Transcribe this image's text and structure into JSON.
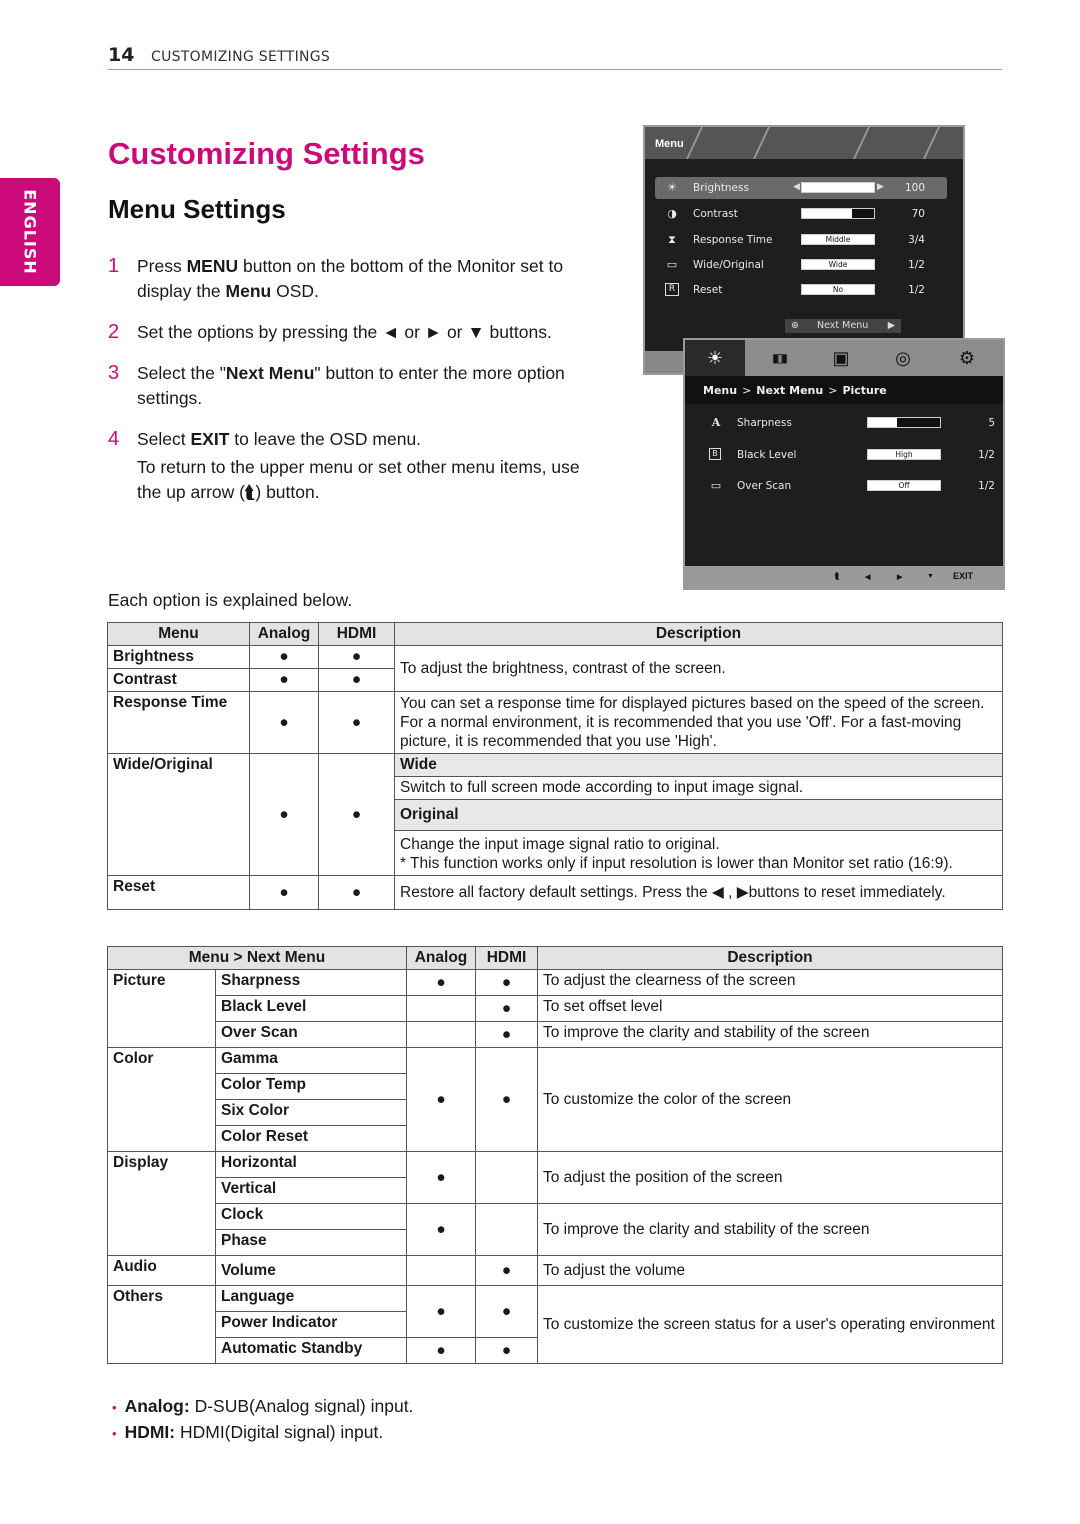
{
  "header": {
    "page_number": "14",
    "section": "CUSTOMIZING SETTINGS"
  },
  "language_tab": "ENGLISH",
  "title": "Customizing Settings",
  "subtitle": "Menu Settings",
  "steps": [
    {
      "num": "1",
      "pre": "Press ",
      "bold1": "MENU",
      "mid": " button on the bottom of the Monitor set to display the ",
      "bold2": "Menu",
      "post": " OSD."
    },
    {
      "num": "2",
      "text": "Set the options by pressing the ◄ or ► or ▼ buttons."
    },
    {
      "num": "3",
      "pre": "Select the \"",
      "bold1": "Next Menu",
      "post": "\" button to enter the more option settings."
    },
    {
      "num": "4",
      "pre": "Select ",
      "bold1": "EXIT",
      "post": " to leave the OSD menu.",
      "sub_pre": "To return to the upper menu or set other menu items, use the up arrow (",
      "sub_icon": "⮬",
      "sub_post": ") button."
    }
  ],
  "explain": "Each option is explained below.",
  "osd_main": {
    "title": "Menu",
    "rows": [
      {
        "icon": "☀",
        "label": "Brightness",
        "value": "100",
        "level": 1.0,
        "selected": true
      },
      {
        "icon": "◑",
        "label": "Contrast",
        "value": "70",
        "level": 0.7
      },
      {
        "icon": "⧗",
        "label": "Response Time",
        "option": "Middle",
        "value": "3/4"
      },
      {
        "icon": "▭",
        "label": "Wide/Original",
        "option": "Wide",
        "value": "1/2"
      },
      {
        "icon": "R",
        "label": "Reset",
        "option": "No",
        "value": "1/2"
      }
    ],
    "next_menu": "Next Menu",
    "plus_icon": "⊕",
    "right_arrow": "▶",
    "left_arrow": "◀"
  },
  "osd_next": {
    "tabs": [
      "☀",
      "▮▯▮",
      "▣",
      "◎",
      "⚙"
    ],
    "breadcrumb": [
      "Menu",
      "Next Menu",
      "Picture"
    ],
    "sep": ">",
    "rows": [
      {
        "icon": "A",
        "label": "Sharpness",
        "value": "5",
        "level": 0.4
      },
      {
        "icon": "B",
        "label": "Black Level",
        "option": "High",
        "value": "1/2"
      },
      {
        "icon": "▭",
        "label": "Over Scan",
        "option": "Off",
        "value": "1/2"
      }
    ],
    "footer": {
      "up": "⮬",
      "left": "◀",
      "right": "▶",
      "down": "▼",
      "exit": "EXIT"
    }
  },
  "table1": {
    "headers": [
      "Menu",
      "Analog",
      "HDMI",
      "Description"
    ],
    "dot": "●",
    "brightness": "Brightness",
    "contrast": "Contrast",
    "bc_desc": "To adjust the brightness, contrast of the screen.",
    "response_time": "Response Time",
    "rt_desc": "You can set a response time for displayed pictures based on the speed of the screen. For a normal environment, it is recommended that you use 'Off'. For a fast-moving picture, it is recommended that you use 'High'.",
    "wide_original": "Wide/Original",
    "wide": "Wide",
    "wide_desc": "Switch to full screen mode according to input image signal.",
    "original": "Original",
    "original_desc": "Change the input image signal ratio to original.",
    "original_note": "* This function works only if input resolution is lower than Monitor set ratio (16:9).",
    "reset": "Reset",
    "reset_desc": "Restore all factory default settings. Press the ◀ , ▶buttons to reset immediately."
  },
  "table2": {
    "headers": [
      "Menu > Next Menu",
      "Analog",
      "HDMI",
      "Description"
    ],
    "dot": "●",
    "groups": {
      "picture": "Picture",
      "color": "Color",
      "display": "Display",
      "audio": "Audio",
      "others": "Others"
    },
    "items": {
      "sharpness": "Sharpness",
      "black_level": "Black Level",
      "over_scan": "Over Scan",
      "gamma": "Gamma",
      "color_temp": "Color Temp",
      "six_color": "Six Color",
      "color_reset": "Color Reset",
      "horizontal": "Horizontal",
      "vertical": "Vertical",
      "clock": "Clock",
      "phase": "Phase",
      "volume": "Volume",
      "language": "Language",
      "power_indicator": "Power Indicator",
      "automatic_standby": "Automatic Standby"
    },
    "desc": {
      "sharpness": "To adjust the clearness of the screen",
      "black_level": "To set offset level",
      "over_scan": "To improve the clarity and stability of the screen",
      "color": "To customize the color of the screen",
      "position": "To adjust the position of the screen",
      "clock_phase": "To improve the clarity and stability of the screen",
      "volume": "To adjust the volume",
      "others": "To customize the screen status for a user's operating environment"
    }
  },
  "notes": [
    {
      "bullet": "•",
      "label": "Analog:",
      "text": " D-SUB(Analog signal) input."
    },
    {
      "bullet": "•",
      "label": "HDMI:",
      "text": " HDMI(Digital signal) input."
    }
  ],
  "colors": {
    "accent": "#cc0a7a",
    "table_header": "#e3e3e3"
  }
}
